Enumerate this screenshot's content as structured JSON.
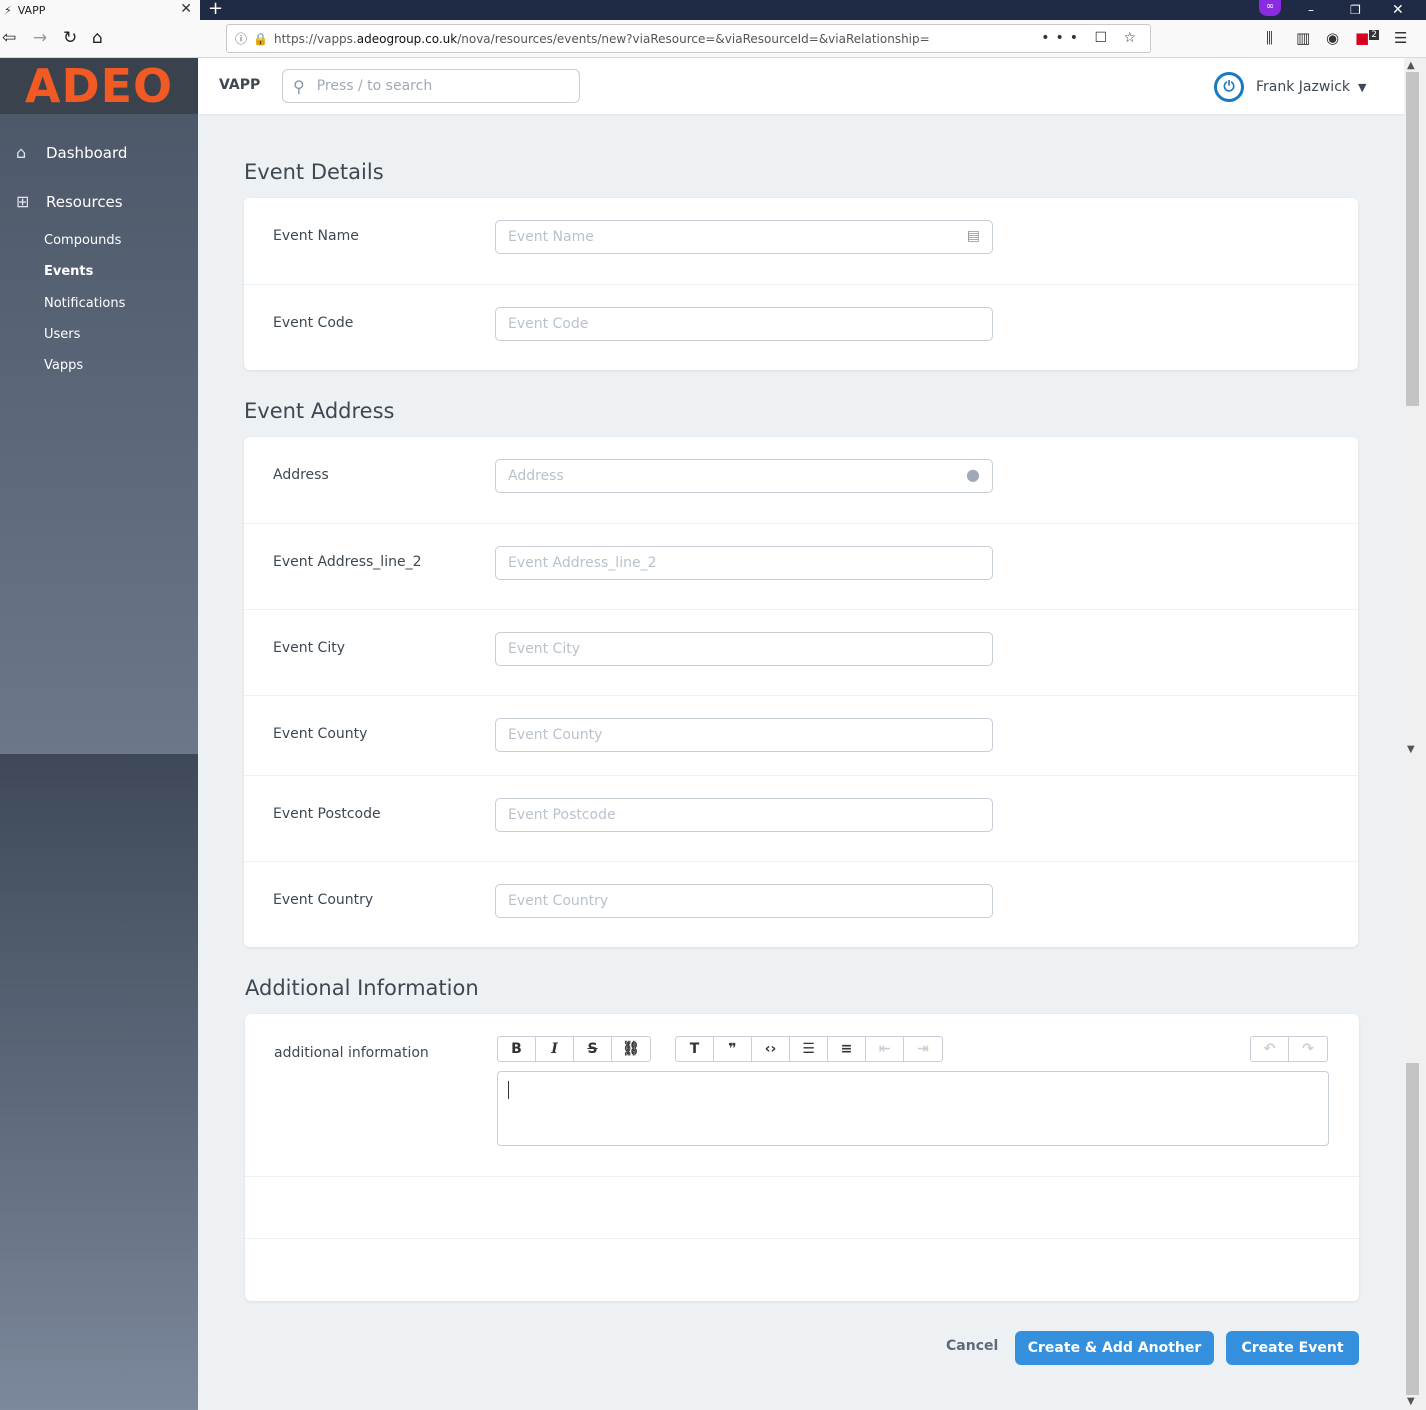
{
  "browser": {
    "tab_title": "VAPP",
    "tab_icon": "bolt-icon",
    "url_prefix": "https://vapps.",
    "url_domain": "adeogroup.co.uk",
    "url_path": "/nova/resources/events/new?viaResource=&viaResourceId=&viaRelationship=",
    "extension_badge": "2"
  },
  "logo": {
    "text": "ADEO",
    "color": "#f15a22"
  },
  "sidebar": {
    "dashboard": "Dashboard",
    "resources": "Resources",
    "items": [
      {
        "label": "Compounds",
        "active": false
      },
      {
        "label": "Events",
        "active": true
      },
      {
        "label": "Notifications",
        "active": false
      },
      {
        "label": "Users",
        "active": false
      },
      {
        "label": "Vapps",
        "active": false
      }
    ]
  },
  "header": {
    "brand": "VAPP",
    "search_placeholder": "Press / to search",
    "user_name": "Frank Jazwick"
  },
  "sections": {
    "event_details": {
      "title": "Event Details",
      "fields": [
        {
          "label": "Event Name",
          "placeholder": "Event Name",
          "value": ""
        },
        {
          "label": "Event Code",
          "placeholder": "Event Code",
          "value": ""
        }
      ]
    },
    "event_address": {
      "title": "Event Address",
      "fields": [
        {
          "label": "Address",
          "placeholder": "Address",
          "value": ""
        },
        {
          "label": "Event Address_line_2",
          "placeholder": "Event Address_line_2",
          "value": ""
        },
        {
          "label": "Event City",
          "placeholder": "Event City",
          "value": ""
        },
        {
          "label": "Event County",
          "placeholder": "Event County",
          "value": ""
        },
        {
          "label": "Event Postcode",
          "placeholder": "Event Postcode",
          "value": ""
        },
        {
          "label": "Event Country",
          "placeholder": "Event Country",
          "value": ""
        }
      ]
    },
    "additional_info": {
      "title": "Additional Information",
      "label": "additional information"
    }
  },
  "actions": {
    "cancel": "Cancel",
    "create_add_another": "Create & Add Another",
    "create": "Create Event"
  },
  "colors": {
    "primary": "#3490dc",
    "accent": "#f15a22",
    "text": "#3d4852"
  }
}
